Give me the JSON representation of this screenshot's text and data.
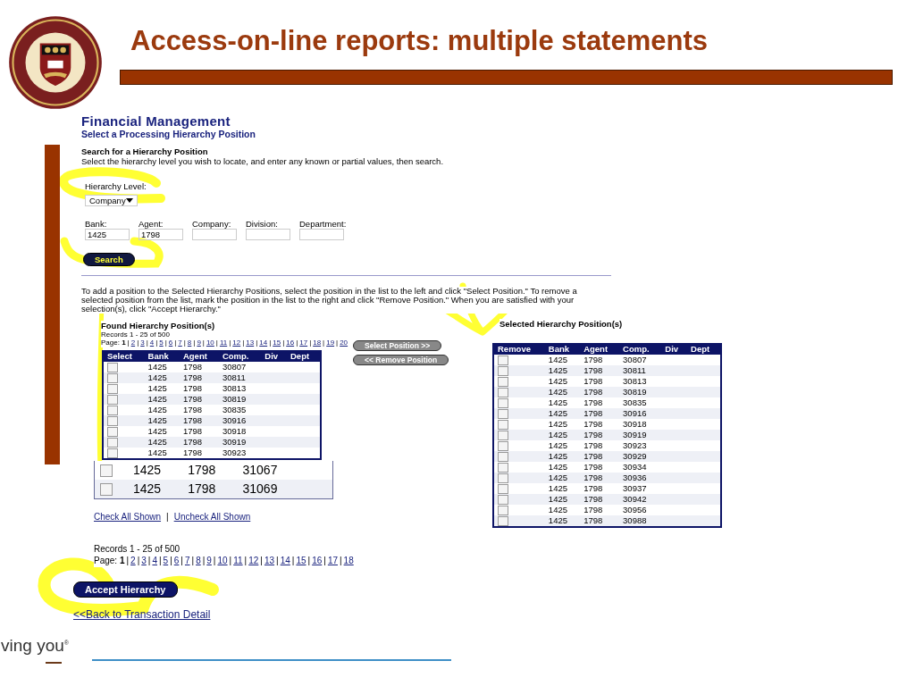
{
  "slide": {
    "title": "Access-on-line reports: multiple statements",
    "footer_text": "ving you",
    "footer_mark": "®"
  },
  "app": {
    "heading": "Financial Management",
    "subheading": "Select a Processing Hierarchy Position",
    "search": {
      "title": "Search for a Hierarchy Position",
      "instructions": "Select the hierarchy level you wish to locate, and enter any known or partial values, then search.",
      "level_label": "Hierarchy Level:",
      "level_value": "Company",
      "fields": [
        {
          "label": "Bank:",
          "value": "1425"
        },
        {
          "label": "Agent:",
          "value": "1798"
        },
        {
          "label": "Company:"
        },
        {
          "label": "Division:"
        },
        {
          "label": "Department:"
        }
      ],
      "button": "Search"
    },
    "help_text": "To add a position to the Selected Hierarchy Positions, select the position in the list to the left and click \"Select Position.\"  To remove a selected position from the list, mark the position in the list to the right and click \"Remove Position.\"  When you are satisfied with your selection(s), click \"Accept Hierarchy.\"",
    "found": {
      "title": "Found Hierarchy Position(s)",
      "records": "Records 1 - 25 of 500",
      "page_label": "Page:",
      "page_separator": "|",
      "pages": [
        {
          "label": "1",
          "selected": true
        },
        {
          "label": "2",
          "selected": false
        },
        {
          "label": "3",
          "selected": false
        },
        {
          "label": "4",
          "selected": false
        },
        {
          "label": "5",
          "selected": false
        },
        {
          "label": "6",
          "selected": false
        },
        {
          "label": "7",
          "selected": false
        },
        {
          "label": "8",
          "selected": false
        },
        {
          "label": "9",
          "selected": false
        },
        {
          "label": "10",
          "selected": false
        },
        {
          "label": "11",
          "selected": false
        },
        {
          "label": "12",
          "selected": false
        },
        {
          "label": "13",
          "selected": false
        },
        {
          "label": "14",
          "selected": false
        },
        {
          "label": "15",
          "selected": false
        },
        {
          "label": "16",
          "selected": false
        },
        {
          "label": "17",
          "selected": false
        },
        {
          "label": "18",
          "selected": false
        },
        {
          "label": "19",
          "selected": false
        },
        {
          "label": "20",
          "selected": false
        }
      ],
      "columns": [
        "Select",
        "Bank",
        "Agent",
        "Comp.",
        "Div",
        "Dept"
      ],
      "rows": [
        {
          "bank": "1425",
          "agent": "1798",
          "comp": "30807",
          "checked": false
        },
        {
          "bank": "1425",
          "agent": "1798",
          "comp": "30811",
          "checked": false
        },
        {
          "bank": "1425",
          "agent": "1798",
          "comp": "30813",
          "checked": false
        },
        {
          "bank": "1425",
          "agent": "1798",
          "comp": "30819",
          "checked": false
        },
        {
          "bank": "1425",
          "agent": "1798",
          "comp": "30835",
          "checked": false
        },
        {
          "bank": "1425",
          "agent": "1798",
          "comp": "30916",
          "checked": false
        },
        {
          "bank": "1425",
          "agent": "1798",
          "comp": "30918",
          "checked": false
        },
        {
          "bank": "1425",
          "agent": "1798",
          "comp": "30919",
          "checked": false
        },
        {
          "bank": "1425",
          "agent": "1798",
          "comp": "30923",
          "checked": false
        }
      ],
      "zoomed_rows": [
        {
          "bank": "1425",
          "agent": "1798",
          "comp": "31067",
          "checked": false
        },
        {
          "bank": "1425",
          "agent": "1798",
          "comp": "31069",
          "checked": false
        }
      ],
      "check_all": "Check All Shown",
      "link_separator": "|",
      "uncheck_all": "Uncheck All Shown"
    },
    "select_button": "Select Position >>",
    "remove_button": "<< Remove Position",
    "selected": {
      "title": "Selected Hierarchy Position(s)",
      "columns": [
        "Remove",
        "Bank",
        "Agent",
        "Comp.",
        "Div",
        "Dept"
      ],
      "rows": [
        {
          "bank": "1425",
          "agent": "1798",
          "comp": "30807",
          "checked": false
        },
        {
          "bank": "1425",
          "agent": "1798",
          "comp": "30811",
          "checked": false
        },
        {
          "bank": "1425",
          "agent": "1798",
          "comp": "30813",
          "checked": false
        },
        {
          "bank": "1425",
          "agent": "1798",
          "comp": "30819",
          "checked": false
        },
        {
          "bank": "1425",
          "agent": "1798",
          "comp": "30835",
          "checked": false
        },
        {
          "bank": "1425",
          "agent": "1798",
          "comp": "30916",
          "checked": false
        },
        {
          "bank": "1425",
          "agent": "1798",
          "comp": "30918",
          "checked": false
        },
        {
          "bank": "1425",
          "agent": "1798",
          "comp": "30919",
          "checked": false
        },
        {
          "bank": "1425",
          "agent": "1798",
          "comp": "30923",
          "checked": false
        },
        {
          "bank": "1425",
          "agent": "1798",
          "comp": "30929",
          "checked": false
        },
        {
          "bank": "1425",
          "agent": "1798",
          "comp": "30934",
          "checked": false
        },
        {
          "bank": "1425",
          "agent": "1798",
          "comp": "30936",
          "checked": false
        },
        {
          "bank": "1425",
          "agent": "1798",
          "comp": "30937",
          "checked": false
        },
        {
          "bank": "1425",
          "agent": "1798",
          "comp": "30942",
          "checked": false
        },
        {
          "bank": "1425",
          "agent": "1798",
          "comp": "30956",
          "checked": false
        },
        {
          "bank": "1425",
          "agent": "1798",
          "comp": "30988",
          "checked": false
        }
      ]
    },
    "bottom_records": "Records 1 - 25 of 500",
    "bottom_page_label": "Page:",
    "bottom_pages": [
      {
        "label": "1",
        "selected": true
      },
      {
        "label": "2",
        "selected": false
      },
      {
        "label": "3",
        "selected": false
      },
      {
        "label": "4",
        "selected": false
      },
      {
        "label": "5",
        "selected": false
      },
      {
        "label": "6",
        "selected": false
      },
      {
        "label": "7",
        "selected": false
      },
      {
        "label": "8",
        "selected": false
      },
      {
        "label": "9",
        "selected": false
      },
      {
        "label": "10",
        "selected": false
      },
      {
        "label": "11",
        "selected": false
      },
      {
        "label": "12",
        "selected": false
      },
      {
        "label": "13",
        "selected": false
      },
      {
        "label": "14",
        "selected": false
      },
      {
        "label": "15",
        "selected": false
      },
      {
        "label": "16",
        "selected": false
      },
      {
        "label": "17",
        "selected": false
      },
      {
        "label": "18",
        "selected": false
      }
    ],
    "accept_button": "Accept Hierarchy",
    "back_link": "<<Back to Transaction Detail"
  }
}
